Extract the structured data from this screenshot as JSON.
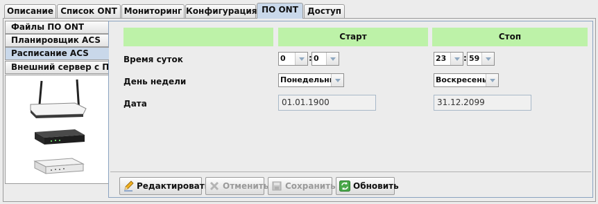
{
  "tabs": [
    {
      "label": "Описание",
      "active": false
    },
    {
      "label": "Список ONT",
      "active": false
    },
    {
      "label": "Мониторинг",
      "active": false
    },
    {
      "label": "Конфигурация",
      "active": false
    },
    {
      "label": "ПО ONT",
      "active": true
    },
    {
      "label": "Доступ",
      "active": false
    }
  ],
  "side_tabs": [
    {
      "label": "Файлы ПО ONT",
      "active": false
    },
    {
      "label": "Планировщик ACS",
      "active": false
    },
    {
      "label": "Расписание ACS",
      "active": true
    },
    {
      "label": "Внешний сервер с ПО",
      "active": false
    }
  ],
  "schedule": {
    "start_header": "Старт",
    "stop_header": "Стоп",
    "time_label": "Время суток",
    "weekday_label": "День недели",
    "date_label": "Дата",
    "start": {
      "hour": "0",
      "minute": "0",
      "weekday": "Понедельник",
      "date": "01.01.1900"
    },
    "stop": {
      "hour": "23",
      "minute": "59",
      "weekday": "Воскресенье",
      "date": "31.12.2099"
    }
  },
  "buttons": {
    "edit": "Редактировать",
    "cancel": "Отменить",
    "save": "Сохранить",
    "refresh": "Обновить"
  },
  "colors": {
    "header_green": "#bdf2a8",
    "active_tab": "#c9d8ea"
  },
  "icons": [
    "pencil-icon",
    "cancel-x-icon",
    "save-icon",
    "refresh-icon"
  ]
}
